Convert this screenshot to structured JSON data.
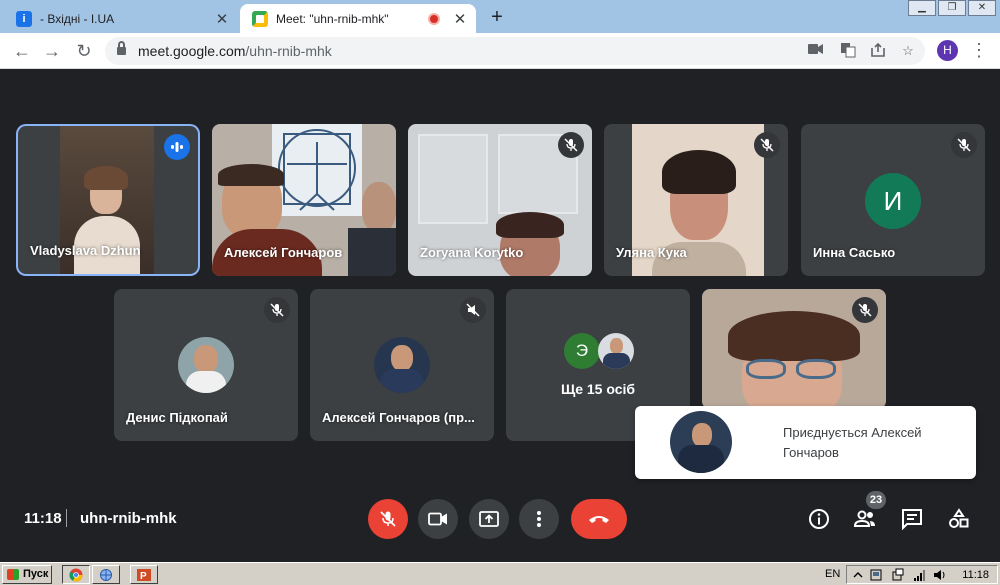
{
  "browser": {
    "tabs": [
      {
        "title": "- Вхідні - I.UA",
        "favicon": "iua-favicon",
        "active": false
      },
      {
        "title": "Meet: \"uhn-rnib-mhk\"",
        "favicon": "google-meet-favicon",
        "active": true
      }
    ],
    "url_host": "meet.google.com",
    "url_path": "/uhn-rnib-mhk",
    "profile_initial": "H"
  },
  "meeting": {
    "participants": [
      {
        "name": "Vladyslava Dzhun",
        "status": "speaking",
        "video": true
      },
      {
        "name": "Алексей Гончаров",
        "status": "unmuted",
        "video": true
      },
      {
        "name": "Zoryana Korytko",
        "status": "muted",
        "video": true
      },
      {
        "name": "Уляна Кука",
        "status": "muted",
        "video": true
      },
      {
        "name": "Инна Сасько",
        "status": "muted",
        "video": false,
        "avatar_letter": "И"
      },
      {
        "name": "Денис Підкопай",
        "status": "muted",
        "video": false
      },
      {
        "name": "Алексей Гончаров (пр...",
        "status": "audio-off",
        "video": false
      },
      {
        "name": "",
        "status": "muted",
        "video": true
      }
    ],
    "others": {
      "label": "Ще 15 осіб",
      "avatar_letter": "Э"
    },
    "toast": {
      "text": "Приєднується Алексей Гончаров"
    },
    "time": "11:18",
    "code": "uhn-rnib-mhk",
    "people_count": "23"
  },
  "taskbar": {
    "start_label": "Пуск",
    "lang": "EN",
    "clock": "11:18"
  },
  "colors": {
    "meet_bg": "#202124",
    "tile_bg": "#3c4043",
    "accent_blue": "#1a73e8",
    "danger_red": "#ea4335",
    "avatar_green": "#137a58"
  }
}
